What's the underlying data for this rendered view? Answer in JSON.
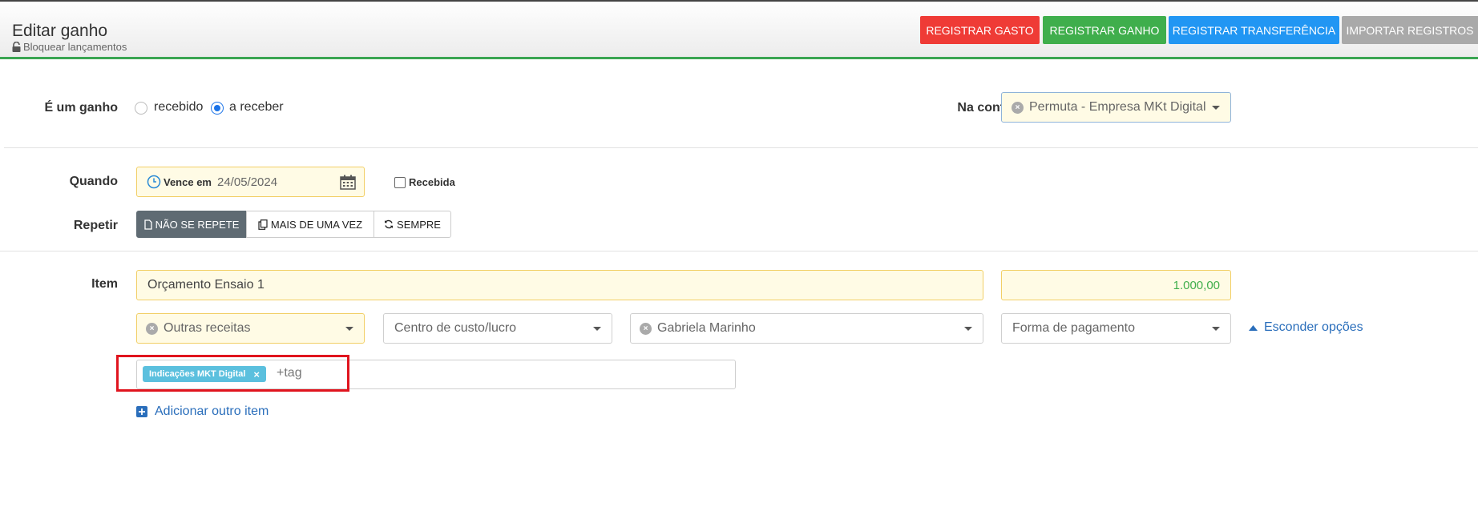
{
  "header": {
    "title": "Editar ganho",
    "lock_label": "Bloquear lançamentos",
    "buttons": {
      "gasto": "REGISTRAR GASTO",
      "ganho": "REGISTRAR GANHO",
      "transferencia": "REGISTRAR TRANSFERÊNCIA",
      "importar": "IMPORTAR REGISTROS"
    }
  },
  "form": {
    "tipo_label": "É um ganho",
    "opt_recebido": "recebido",
    "opt_a_receber": "a receber",
    "selected_option": "a receber",
    "conta_label": "Na conta",
    "conta_value": "Permuta - Empresa MKt Digital",
    "quando_label": "Quando",
    "vence_label": "Vence em",
    "date_value": "24/05/2024",
    "recebida_label": "Recebida",
    "recebida_checked": false,
    "repetir_label": "Repetir",
    "repeat_options": [
      "NÃO SE REPETE",
      "MAIS DE UMA VEZ",
      "SEMPRE"
    ],
    "repeat_selected": "NÃO SE REPETE",
    "item_label": "Item",
    "item_value": "Orçamento Ensaio 1",
    "amount_value": "1.000,00",
    "categoria_value": "Outras receitas",
    "centro_placeholder": "Centro de custo/lucro",
    "pessoa_value": "Gabriela Marinho",
    "forma_placeholder": "Forma de pagamento",
    "esconder_label": "Esconder opções",
    "tag_chip": "Indicações MKT Digital",
    "tag_remove": "×",
    "tag_placeholder": "+tag",
    "add_item_label": "Adicionar outro item"
  },
  "colors": {
    "danger": "#ef3b36",
    "success": "#3fae4c",
    "primary": "#2196f3",
    "muted": "#a9a9a9",
    "tag": "#5bc0de",
    "amount": "#3fae4c",
    "highlight": "#e0141e"
  },
  "icons": [
    "lock-icon",
    "clock-icon",
    "calendar-icon",
    "file-icon",
    "copy-icon",
    "refresh-icon",
    "chevron-up-icon",
    "plus-square-icon",
    "clear-icon",
    "chevron-down-icon"
  ]
}
